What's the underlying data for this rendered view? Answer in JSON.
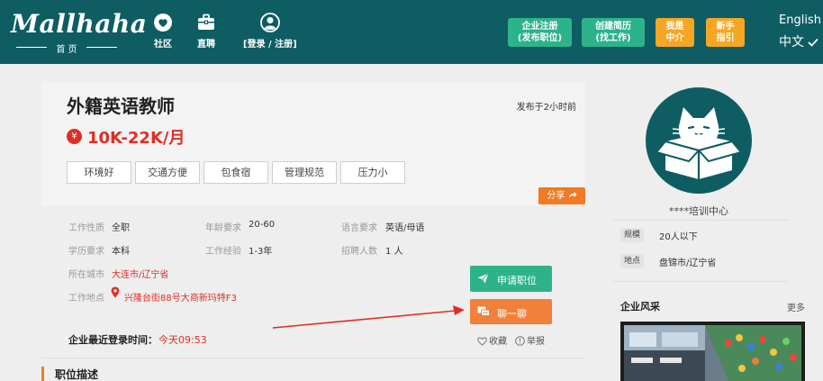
{
  "header": {
    "logo_text": "Mallhaha",
    "logo_sub": "首 页",
    "nav": [
      {
        "label": "社区",
        "icon": "chat-bubble-icon"
      },
      {
        "label": "直聘",
        "icon": "briefcase-icon"
      },
      {
        "label": "[登录 / 注册]",
        "icon": "user-icon"
      }
    ],
    "buttons": [
      {
        "label": "企业注册\n(发布职位)"
      },
      {
        "label": "创建简历\n(找工作)"
      },
      {
        "label": "我是\n中介"
      },
      {
        "label": "新手\n指引"
      }
    ],
    "lang_en": "English",
    "lang_zh": "中文"
  },
  "job": {
    "title": "外籍英语教师",
    "posted": "发布于2小时前",
    "salary_icon": "¥",
    "salary": "10K-22K/月",
    "tags": [
      "环境好",
      "交通方便",
      "包食宿",
      "管理规范",
      "压力小"
    ],
    "share_label": "分享",
    "details": {
      "type_label": "工作性质",
      "type": "全职",
      "age_label": "年龄要求",
      "age": "20-60",
      "lang_label": "语言要求",
      "lang": "英语/母语",
      "edu_label": "学历要求",
      "edu": "本科",
      "exp_label": "工作经验",
      "exp": "1-3年",
      "num_label": "招聘人数",
      "num": "1 人",
      "city_label": "所在城市",
      "city": "大连市/辽宁省",
      "addr_label": "工作地点",
      "addr": "兴隆台街88号大商新玛特F3"
    },
    "apply_label": "申请职位",
    "chat_label": "聊一聊",
    "login_label": "企业最近登录时间：",
    "login_value": "今天09:53",
    "fav_label": "收藏",
    "report_label": "举报",
    "section_title": "职位描述"
  },
  "company": {
    "name": "****培训中心",
    "scale_label": "规模",
    "scale": "20人以下",
    "loc_label": "地点",
    "loc": "盘锦市/辽宁省",
    "style_title": "企业风采",
    "more": "更多"
  },
  "colors": {
    "header": "#0e5d63",
    "green": "#2db38a",
    "orange": "#f5a623",
    "salary_red": "#e02e24",
    "chat_orange": "#f0803a"
  }
}
